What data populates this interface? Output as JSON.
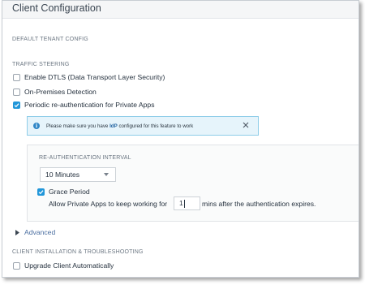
{
  "window": {
    "title": "Client Configuration"
  },
  "sections": {
    "default_tenant": "DEFAULT TENANT CONFIG",
    "traffic_steering": "TRAFFIC STEERING",
    "client_installation": "CLIENT INSTALLATION & TROUBLESHOOTING"
  },
  "traffic_steering": {
    "items": [
      {
        "label": "Enable DTLS (Data Transport Layer Security)",
        "checked": false
      },
      {
        "label": "On-Premises Detection",
        "checked": false
      },
      {
        "label": "Periodic re-authentication for Private Apps",
        "checked": true
      }
    ]
  },
  "info_banner": {
    "text_before": "Please make sure you have ",
    "idp": "IdP",
    "text_after": " configured for this feature to work",
    "icon": "info-icon",
    "close_icon": "close-icon",
    "color_bg": "#e6f4fb",
    "color_border": "#8fcde9"
  },
  "reauth": {
    "label": "RE-AUTHENTICATION INTERVAL",
    "interval_value": "10 Minutes",
    "grace_period_label": "Grace Period",
    "grace_period_checked": true,
    "allow_text_before": "Allow Private Apps to keep working for",
    "grace_minutes_value": "1",
    "allow_text_after": "mins after the authentication expires."
  },
  "advanced": {
    "label": "Advanced",
    "icon": "triangle-right-icon"
  },
  "client_installation": {
    "items": [
      {
        "label": "Upgrade Client Automatically",
        "checked": false
      }
    ]
  },
  "colors": {
    "accent": "#2196d9",
    "link": "#4a6ea0"
  }
}
